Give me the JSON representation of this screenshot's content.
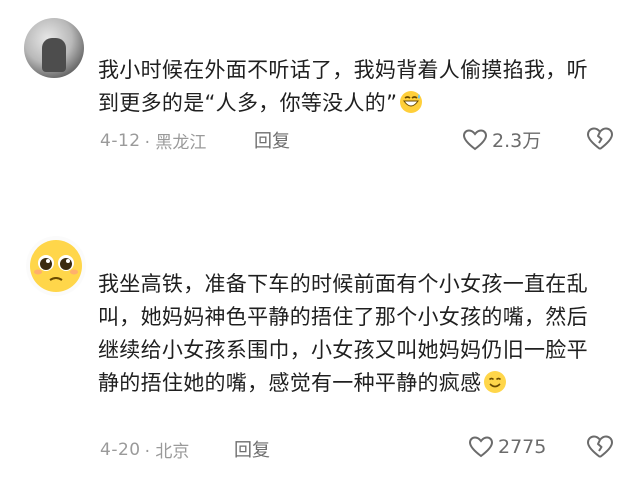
{
  "comments": [
    {
      "text": "我小时候在外面不听话了，我妈背着人偷摸掐我，听到更多的是“人多，你等没人的”",
      "date": "4-12",
      "location": "· 黑龙江",
      "reply_label": "回复",
      "likes": "2.3万",
      "avatar_icon": "user-photo-avatar",
      "trailing_emoji": "grinning-sweat-emoji"
    },
    {
      "text": "我坐高铁，准备下车的时候前面有个小女孩一直在乱叫，她妈妈神色平静的捂住了那个小女孩的嘴，然后继续给小女孩系围巾，小女孩又叫她妈妈仍旧一脸平静的捂住她的嘴，感觉有一种平静的疯感",
      "date": "4-20",
      "location": "· 北京",
      "reply_label": "回复",
      "likes": "2775",
      "avatar_icon": "pleading-face-avatar",
      "trailing_emoji": "smile-emoji"
    }
  ],
  "colors": {
    "text": "#1f1f1f",
    "meta": "#9a9a9a",
    "icon": "#6b6b6b"
  }
}
